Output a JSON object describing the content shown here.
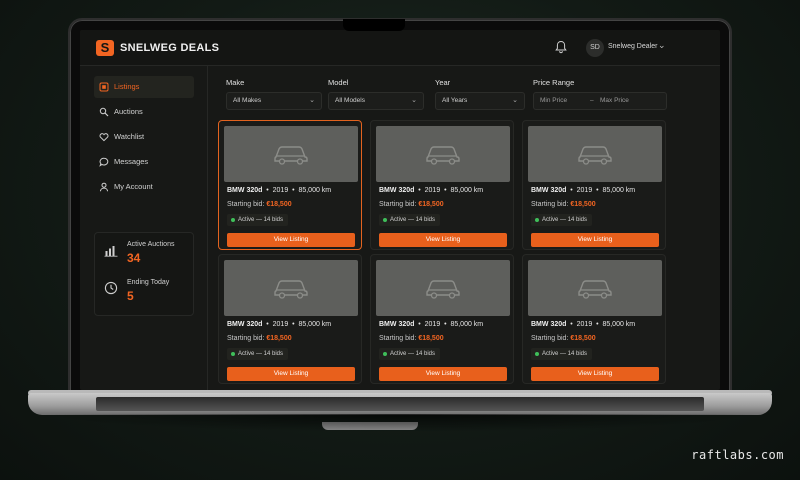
{
  "header": {
    "brand": "SNELWEG DEALS",
    "logo_letter": "S",
    "user_initials": "SD",
    "user_name": "Snelweg Dealer"
  },
  "sidebar": {
    "items": [
      {
        "label": "Listings",
        "icon": "listings-icon",
        "active": true
      },
      {
        "label": "Auctions",
        "icon": "gavel-icon",
        "active": false
      },
      {
        "label": "Watchlist",
        "icon": "heart-icon",
        "active": false
      },
      {
        "label": "Messages",
        "icon": "message-icon",
        "active": false
      },
      {
        "label": "My Account",
        "icon": "user-icon",
        "active": false
      }
    ],
    "stats": [
      {
        "label": "Active Auctions",
        "value": "34",
        "icon": "bar-chart-icon"
      },
      {
        "label": "Ending Today",
        "value": "5",
        "icon": "clock-icon"
      }
    ]
  },
  "filters": {
    "make": {
      "label": "Make",
      "value": "All Makes"
    },
    "model": {
      "label": "Model",
      "value": "All Models"
    },
    "year": {
      "label": "Year",
      "value": "All Years"
    },
    "price": {
      "label": "Price Range",
      "min_placeholder": "Min Price",
      "separator": "–",
      "max_placeholder": "Max Price"
    }
  },
  "listings": [
    {
      "model": "BMW 320d",
      "year": "2019",
      "km": "85,000 km",
      "bid_label": "Starting bid:",
      "price": "€18,500",
      "status": "Active — 14 bids",
      "button": "View Listing"
    },
    {
      "model": "BMW 320d",
      "year": "2019",
      "km": "85,000 km",
      "bid_label": "Starting bid:",
      "price": "€18,500",
      "status": "Active — 14 bids",
      "button": "View Listing"
    },
    {
      "model": "BMW 320d",
      "year": "2019",
      "km": "85,000 km",
      "bid_label": "Starting bid:",
      "price": "€18,500",
      "status": "Active — 14 bids",
      "button": "View Listing"
    },
    {
      "model": "BMW 320d",
      "year": "2019",
      "km": "85,000 km",
      "bid_label": "Starting bid:",
      "price": "€18,500",
      "status": "Active — 14 bids",
      "button": "View Listing"
    },
    {
      "model": "BMW 320d",
      "year": "2019",
      "km": "85,000 km",
      "bid_label": "Starting bid:",
      "price": "€18,500",
      "status": "Active — 14 bids",
      "button": "View Listing"
    },
    {
      "model": "BMW 320d",
      "year": "2019",
      "km": "85,000 km",
      "bid_label": "Starting bid:",
      "price": "€18,500",
      "status": "Active — 14 bids",
      "button": "View Listing"
    }
  ],
  "colors": {
    "accent": "#f26522",
    "status_active": "#3fbf5a",
    "background": "#171816"
  },
  "watermark": "raftlabs.com"
}
